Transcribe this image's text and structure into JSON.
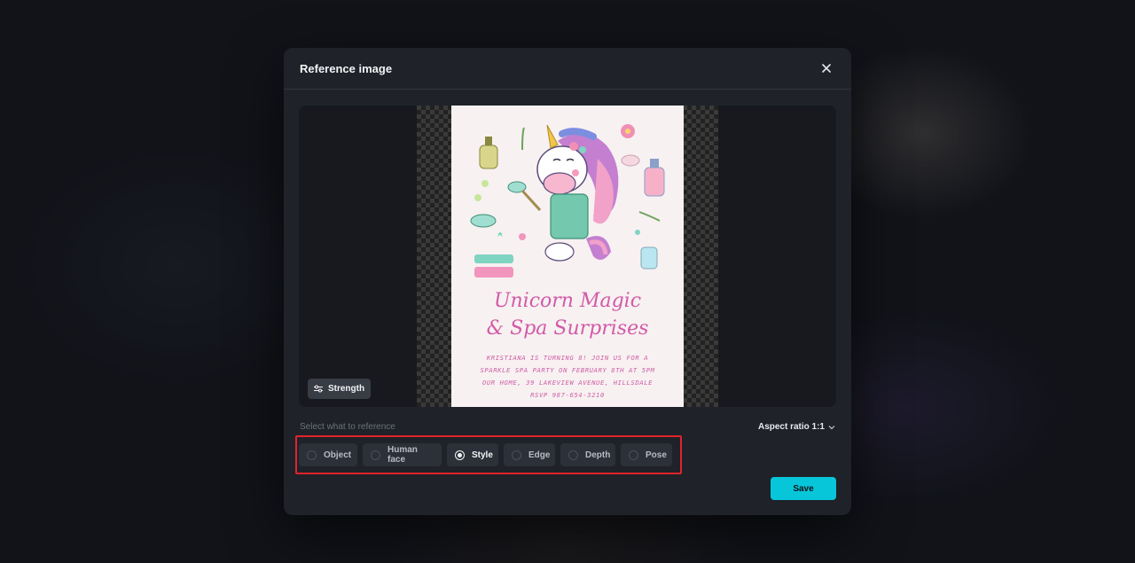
{
  "modal": {
    "title": "Reference image",
    "close_icon": "close-icon"
  },
  "preview": {
    "strength_label": "Strength",
    "strength_icon": "sliders-icon",
    "image": {
      "heading_line1": "Unicorn Magic",
      "heading_line2": "& Spa Surprises",
      "lines": [
        "KRISTIANA IS TURNING 8! JOIN US FOR A",
        "SPARKLE SPA PARTY ON FEBRUARY 8TH AT 5PM",
        "OUR HOME, 39 LAKEVIEW AVENUE, HILLSDALE",
        "RSVP 987-654-3210"
      ]
    }
  },
  "reference": {
    "label": "Select what to reference",
    "aspect_ratio": "Aspect ratio 1:1",
    "options": [
      {
        "label": "Object",
        "selected": false
      },
      {
        "label": "Human face",
        "selected": false
      },
      {
        "label": "Style",
        "selected": true
      },
      {
        "label": "Edge",
        "selected": false
      },
      {
        "label": "Depth",
        "selected": false
      },
      {
        "label": "Pose",
        "selected": false
      }
    ]
  },
  "actions": {
    "save_label": "Save"
  },
  "colors": {
    "accent": "#08c6da",
    "highlight": "#e0242a",
    "modal_bg": "#1f2229"
  }
}
